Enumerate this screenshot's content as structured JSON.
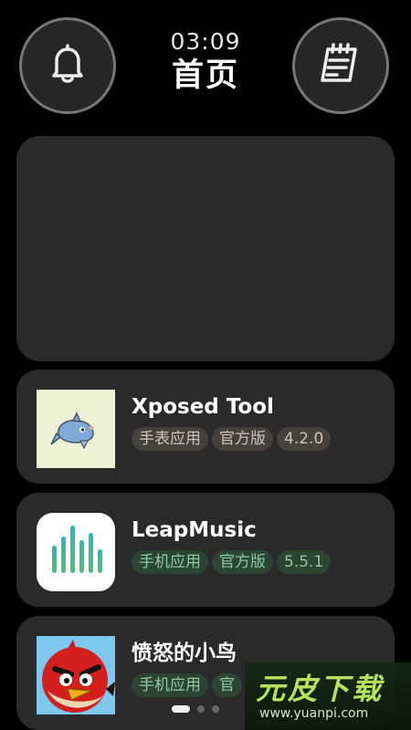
{
  "header": {
    "time": "03:09",
    "title": "首页"
  },
  "icons": {
    "left": "bell-icon",
    "right": "calendar-icon"
  },
  "apps": [
    {
      "name": "Xposed Tool",
      "icon": "xposed-dolphin-icon",
      "tags": [
        "手表应用",
        "官方版",
        "4.2.0"
      ],
      "tag_style": "gray"
    },
    {
      "name": "LeapMusic",
      "icon": "leapmusic-bars-icon",
      "tags": [
        "手机应用",
        "官方版",
        "5.5.1"
      ],
      "tag_style": "green"
    },
    {
      "name": "愤怒的小鸟",
      "icon": "angry-birds-icon",
      "tags": [
        "手机应用",
        "官"
      ],
      "tag_style": "green"
    }
  ],
  "pagination": {
    "count": 3,
    "active": 0
  },
  "watermark": {
    "title": "元皮下载",
    "url": "www.yuanpi.com"
  },
  "colors": {
    "background": "#000000",
    "card": "#2a2a2a",
    "tag_gray_bg": "#45413d",
    "tag_green_bg": "#2b4532",
    "tag_green_text": "#8fc7a0"
  }
}
